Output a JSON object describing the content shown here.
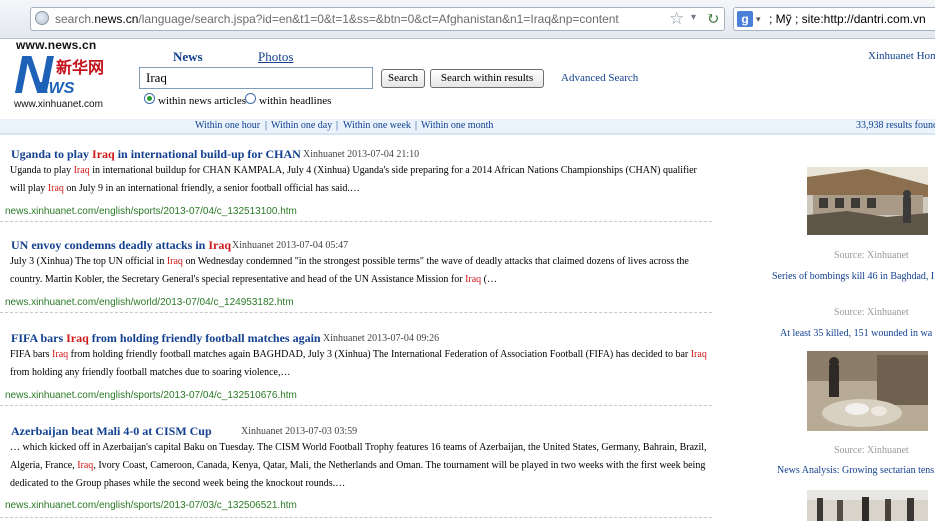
{
  "browser": {
    "url_prefix": "search.",
    "url_host": "news.cn",
    "url_rest": "/language/search.jspa?id=en&t1=0&t=1&ss=&btn=0&ct=Afghanistan&n1=Iraq&np=content",
    "search_engine_letter": "g",
    "search_text": "; Mỹ ; site:http://dantri.com.vn"
  },
  "logo": {
    "site": "www.news.cn",
    "n_letter": "N",
    "ews": "EWS",
    "chinese": "新华网",
    "domain": "www.xinhuanet.com"
  },
  "header": {
    "tab_news": "News",
    "tab_photos": "Photos",
    "query_value": "Iraq",
    "search_button": "Search",
    "within_button": "Search within results",
    "advanced_link": "Advanced Search",
    "home_link": "Xinhuanet Home",
    "radio_news": "within news articles",
    "radio_headlines": "within headlines"
  },
  "filters": {
    "hour": "Within one hour",
    "day": "Within one day",
    "week": "Within one week",
    "month": "Within one month",
    "separator": "|",
    "count": "33,938 results found"
  },
  "results": [
    {
      "title_pre": "Uganda to play ",
      "title_hl": "Iraq",
      "title_post": " in international build-up for CHAN",
      "meta": "Xinhuanet 2013-07-04 21:10",
      "snippet1_pre": "Uganda to play ",
      "snippet1_hl": "Iraq",
      "snippet1_post": " in international buildup for CHAN KAMPALA, July 4 (Xinhua) Uganda's side preparing for a 2014 African Nations Championships (CHAN) qualifier",
      "snippet2_pre": "will play ",
      "snippet2_hl": "Iraq",
      "snippet2_post": " on July 9 in an international friendly, a senior football official has said.…",
      "url": "news.xinhuanet.com/english/sports/2013-07/04/c_132513100.htm"
    },
    {
      "title_pre": "UN envoy condemns deadly attacks in ",
      "title_hl": "Iraq",
      "title_post": "",
      "meta": "Xinhuanet 2013-07-04 05:47",
      "snippet1_pre": "July 3 (Xinhua) The top UN official in ",
      "snippet1_hl": "Iraq",
      "snippet1_post": " on Wednesday condemned \"in the strongest possible terms\" the wave of deadly attacks that claimed dozens of lives across the",
      "snippet2_pre": "country. Martin Kobler, the Secretary General's special representative and head of the UN Assistance Mission for ",
      "snippet2_hl": "Iraq",
      "snippet2_post": " (…",
      "url": "news.xinhuanet.com/english/world/2013-07/04/c_124953182.htm"
    },
    {
      "title_pre": "FIFA bars ",
      "title_hl": "Iraq",
      "title_post": " from holding friendly football matches again",
      "meta": "Xinhuanet 2013-07-04 09:26",
      "snippet1_pre": "FIFA bars ",
      "snippet1_hl": "Iraq",
      "snippet1_post": " from holding friendly football matches again BAGHDAD, July 3 (Xinhua) The International Federation of Association Football (FIFA) has decided to bar ",
      "snippet1_hl2": "Iraq",
      "snippet2_pre": "from holding any friendly football matches due to soaring violence,…",
      "snippet2_hl": "",
      "snippet2_post": "",
      "url": "news.xinhuanet.com/english/sports/2013-07/04/c_132510676.htm"
    },
    {
      "title_pre": "Azerbaijan beat Mali 4-0 at CISM Cup",
      "title_hl": "",
      "title_post": "",
      "meta": "Xinhuanet 2013-07-03 03:59",
      "snippet1_pre": "… which kicked off in Azerbaijan's capital Baku on Tuesday. The CISM World Football Trophy features 16 teams of Azerbaijan, the United States, Germany, Bahrain, Brazil,",
      "snippet1_hl": "",
      "snippet1_post": "",
      "snippet2_pre": "Algeria, France, ",
      "snippet2_hl": "Iraq",
      "snippet2_post": ", Ivory Coast, Cameroon, Canada, Kenya, Qatar, Mali, the Netherlands and Oman. The tournament will be played in two weeks with the first week being",
      "snippet3": "dedicated to the Group phases while the second week being the knockout rounds.…",
      "url": "news.xinhuanet.com/english/sports/2013-07/03/c_132506521.htm"
    }
  ],
  "sidebar": [
    {
      "source": "Source: Xinhuanet",
      "caption": "Series of bombings kill 46 in Baghdad, I"
    },
    {
      "source": "Source: Xinhuanet",
      "caption": "At least 35 killed, 151 wounded in wa"
    },
    {
      "source": "Source: Xinhuanet",
      "caption": "News Analysis: Growing sectarian tensi"
    }
  ]
}
